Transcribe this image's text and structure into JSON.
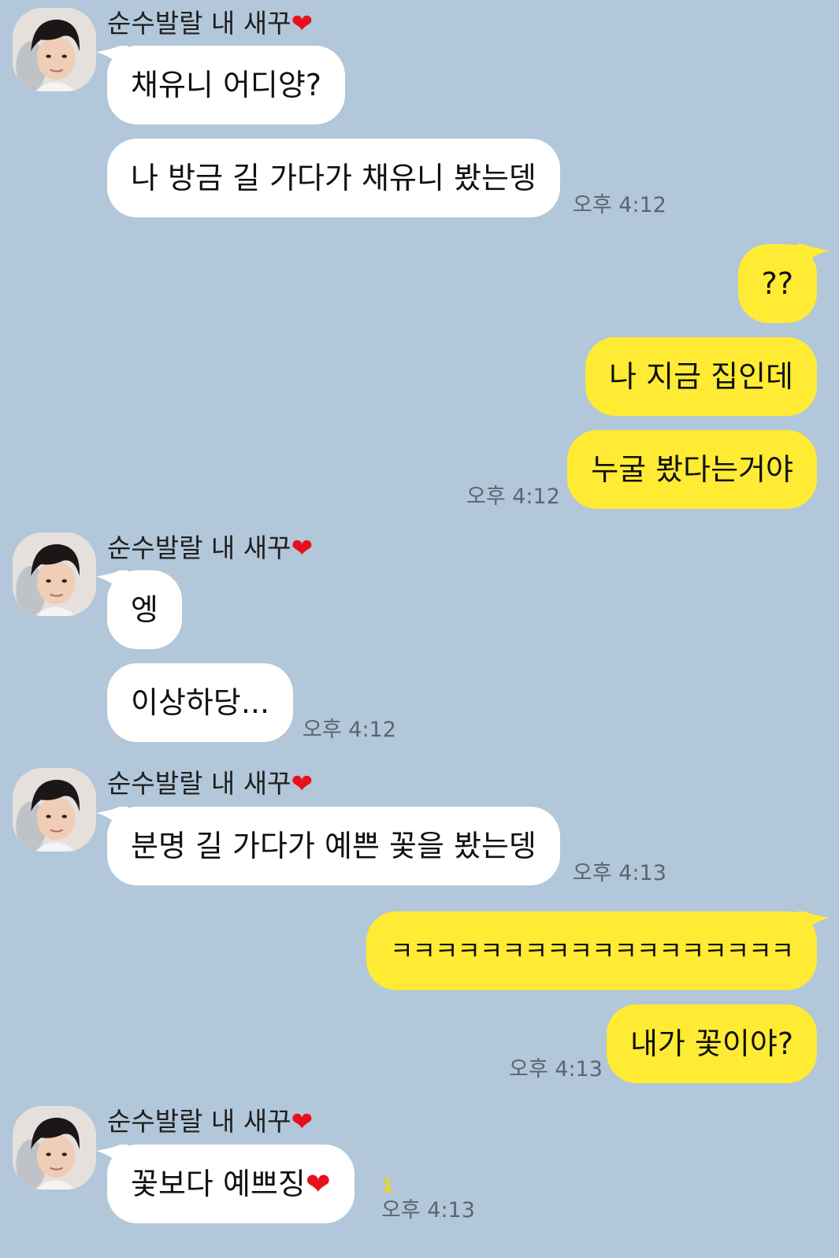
{
  "sender": {
    "name": "순수발랄 내 새꾸",
    "heart": "❤",
    "avatar": "avatar-icon"
  },
  "colors": {
    "background": "#b2c7d9",
    "incoming_bubble": "#ffffff",
    "outgoing_bubble": "#ffeb33",
    "heart": "#e8101c",
    "unread": "#f3d21a"
  },
  "messages": [
    {
      "from": "them",
      "text": "채유니 어디양?"
    },
    {
      "from": "them",
      "text": "나 방금 길 가다가 채유니 봤는뎅",
      "time": "오후 4:12"
    },
    {
      "from": "me",
      "text": "??"
    },
    {
      "from": "me",
      "text": "나 지금 집인데"
    },
    {
      "from": "me",
      "text": "누굴 봤다는거야",
      "time": "오후 4:12"
    },
    {
      "from": "them",
      "text": "엥"
    },
    {
      "from": "them",
      "text": "이상하당...",
      "time": "오후 4:12"
    },
    {
      "from": "them",
      "text": "분명 길 가다가 예쁜 꽃을 봤는뎅",
      "time": "오후 4:13"
    },
    {
      "from": "me",
      "text": "ㅋㅋㅋㅋㅋㅋㅋㅋㅋㅋㅋㅋㅋㅋㅋㅋㅋㅋ"
    },
    {
      "from": "me",
      "text": "내가 꽃이야?",
      "time": "오후 4:13"
    },
    {
      "from": "them",
      "text": "꽃보다 예쁘징",
      "heart": "❤",
      "time": "오후 4:13",
      "unread": "1"
    }
  ]
}
